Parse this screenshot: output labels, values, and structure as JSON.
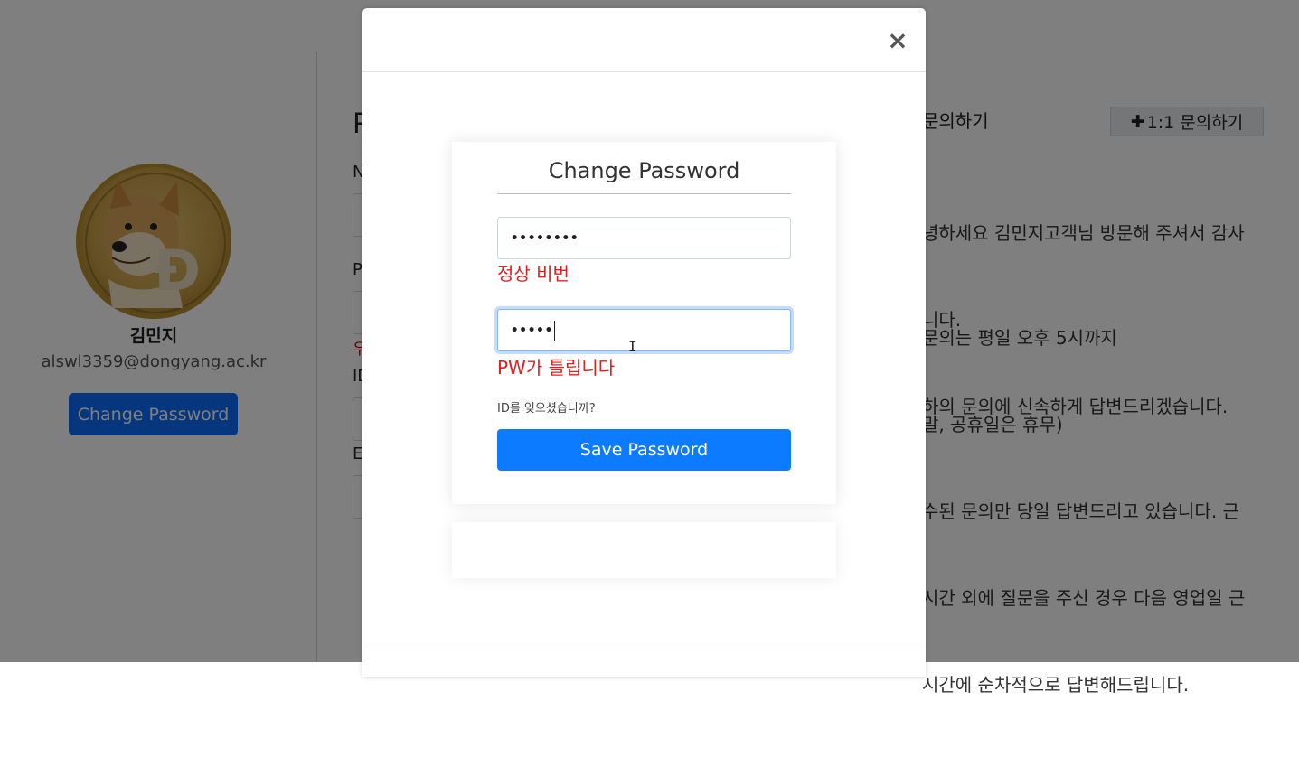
{
  "profile": {
    "name": "김민지",
    "email": "alswl3359@dongyang.ac.kr",
    "change_password_label": "Change Password"
  },
  "form": {
    "title_partial": "P",
    "label_1": "N",
    "label_2": "P",
    "warn_partial": "우",
    "label_3": "ID",
    "label_4": "E"
  },
  "inquiry": {
    "heading": "문의하기",
    "button_label": "1:1 문의하기",
    "lines": [
      "녕하세요 김민지고객님 방문해 주셔서 감사",
      "니다.",
      "하의 문의에 신속하게 답변드리겠습니다.",
      "",
      "문의는 평일 오후 5시까지",
      "말, 공휴일은 휴무)",
      "수된 문의만 당일 답변드리고 있습니다. 근",
      "시간 외에 질문을 주신 경우 다음 영업일 근",
      "시간에 순차적으로 답변해드립니다."
    ]
  },
  "modal": {
    "close_symbol": "×",
    "title": "Change Password",
    "current_password_value": "••••••••",
    "current_password_message": "정상 비번",
    "new_password_value": "•••••",
    "new_password_message": "PW가 틀립니다",
    "forgot_link": "ID를 잊으셨습니까?",
    "save_label": "Save Password"
  },
  "colors": {
    "primary": "#0d6efd",
    "error": "#e02020",
    "backdrop": "rgba(0,0,0,0.5)"
  },
  "icons": {
    "avatar": "doge-coin-avatar",
    "plus": "plus-icon",
    "close": "close-icon",
    "cursor": "text-cursor-icon"
  }
}
